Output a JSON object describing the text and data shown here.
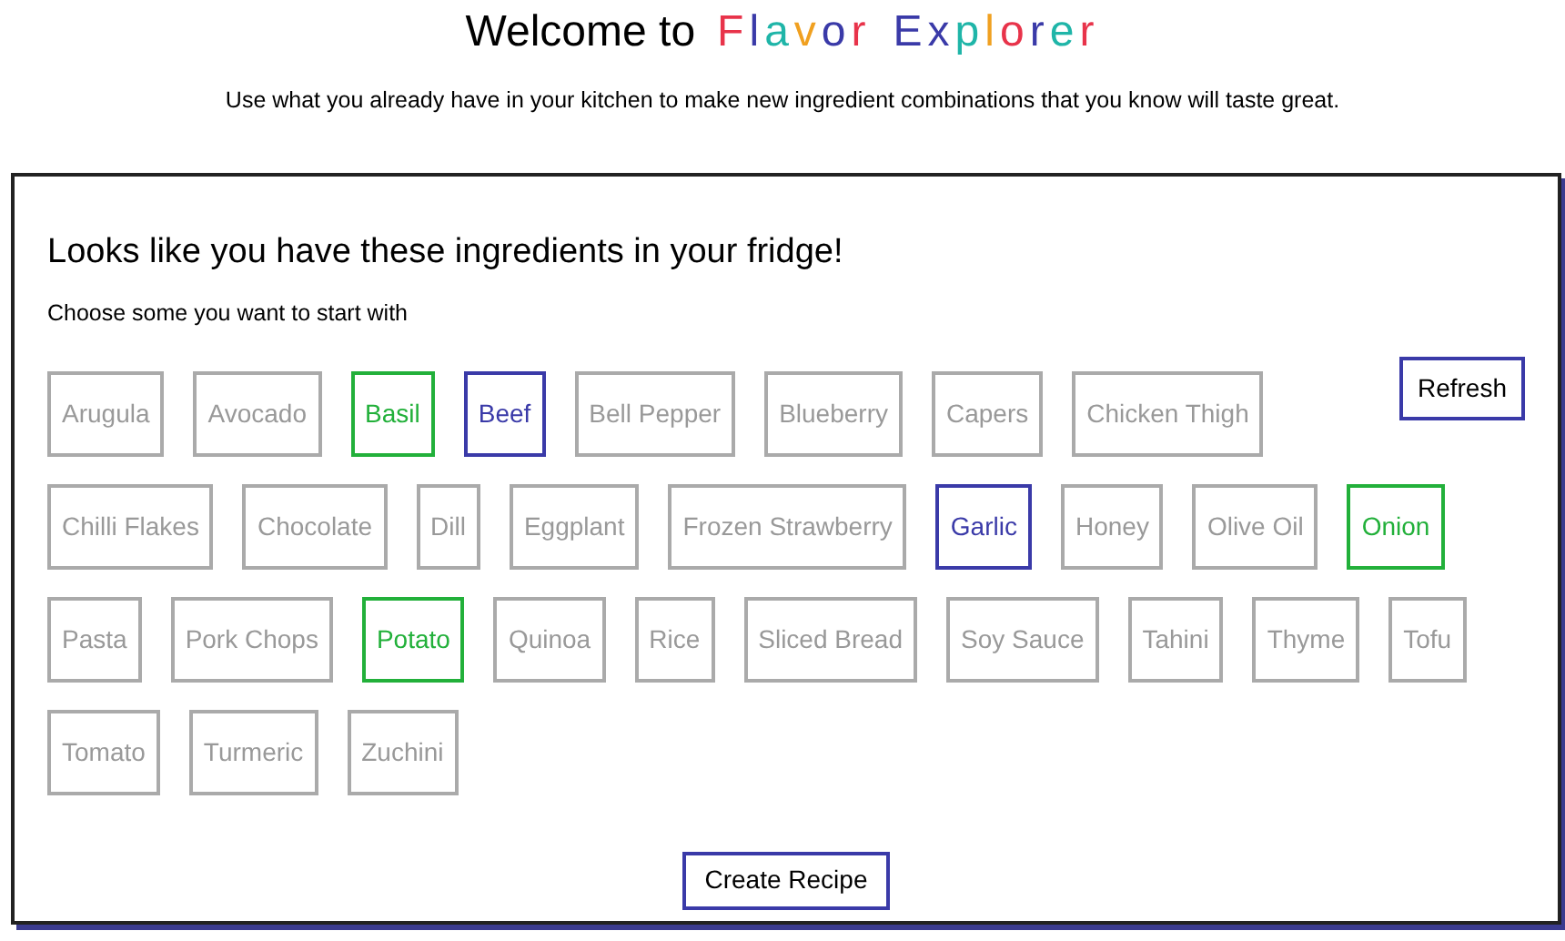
{
  "header": {
    "title_prefix": "Welcome to",
    "brand_words": [
      [
        {
          "text": "F",
          "color": "#e8334a"
        },
        {
          "text": "l",
          "color": "#3a3aa8"
        },
        {
          "text": "a",
          "color": "#1fb5a8"
        },
        {
          "text": "v",
          "color": "#f0a020"
        },
        {
          "text": "o",
          "color": "#3a3aa8"
        },
        {
          "text": "r",
          "color": "#e8334a"
        }
      ],
      [
        {
          "text": "E",
          "color": "#3a3aa8"
        },
        {
          "text": "x",
          "color": "#3a3aa8"
        },
        {
          "text": "p",
          "color": "#1fb5a8"
        },
        {
          "text": "l",
          "color": "#f0a020"
        },
        {
          "text": "o",
          "color": "#e8334a"
        },
        {
          "text": "r",
          "color": "#3a3aa8"
        },
        {
          "text": "e",
          "color": "#1fb5a8"
        },
        {
          "text": "r",
          "color": "#e8334a"
        }
      ]
    ],
    "subtitle": "Use what you already have in your kitchen to make new ingredient combinations that you know will taste great."
  },
  "panel": {
    "heading": "Looks like you have these ingredients in your fridge!",
    "instruction": "Choose some you want to start with",
    "refresh_button": "Refresh",
    "create_button": "Create Recipe",
    "ingredients": [
      {
        "label": "Arugula",
        "selected": false
      },
      {
        "label": "Avocado",
        "selected": false
      },
      {
        "label": "Basil",
        "selected": true,
        "color": "#22b03a"
      },
      {
        "label": "Beef",
        "selected": true,
        "color": "#3a3aa8"
      },
      {
        "label": "Bell Pepper",
        "selected": false
      },
      {
        "label": "Blueberry",
        "selected": false
      },
      {
        "label": "Capers",
        "selected": false
      },
      {
        "label": "Chicken Thigh",
        "selected": false
      },
      {
        "label": "Chilli Flakes",
        "selected": false
      },
      {
        "label": "Chocolate",
        "selected": false
      },
      {
        "label": "Dill",
        "selected": false
      },
      {
        "label": "Eggplant",
        "selected": false
      },
      {
        "label": "Frozen Strawberry",
        "selected": false
      },
      {
        "label": "Garlic",
        "selected": true,
        "color": "#3a3aa8"
      },
      {
        "label": "Honey",
        "selected": false
      },
      {
        "label": "Olive Oil",
        "selected": false
      },
      {
        "label": "Onion",
        "selected": true,
        "color": "#22b03a"
      },
      {
        "label": "Pasta",
        "selected": false
      },
      {
        "label": "Pork Chops",
        "selected": false
      },
      {
        "label": "Potato",
        "selected": true,
        "color": "#22b03a"
      },
      {
        "label": "Quinoa",
        "selected": false
      },
      {
        "label": "Rice",
        "selected": false
      },
      {
        "label": "Sliced Bread",
        "selected": false
      },
      {
        "label": "Soy Sauce",
        "selected": false
      },
      {
        "label": "Tahini",
        "selected": false
      },
      {
        "label": "Thyme",
        "selected": false
      },
      {
        "label": "Tofu",
        "selected": false
      },
      {
        "label": "Tomato",
        "selected": false
      },
      {
        "label": "Turmeric",
        "selected": false
      },
      {
        "label": "Zuchini",
        "selected": false
      }
    ]
  }
}
